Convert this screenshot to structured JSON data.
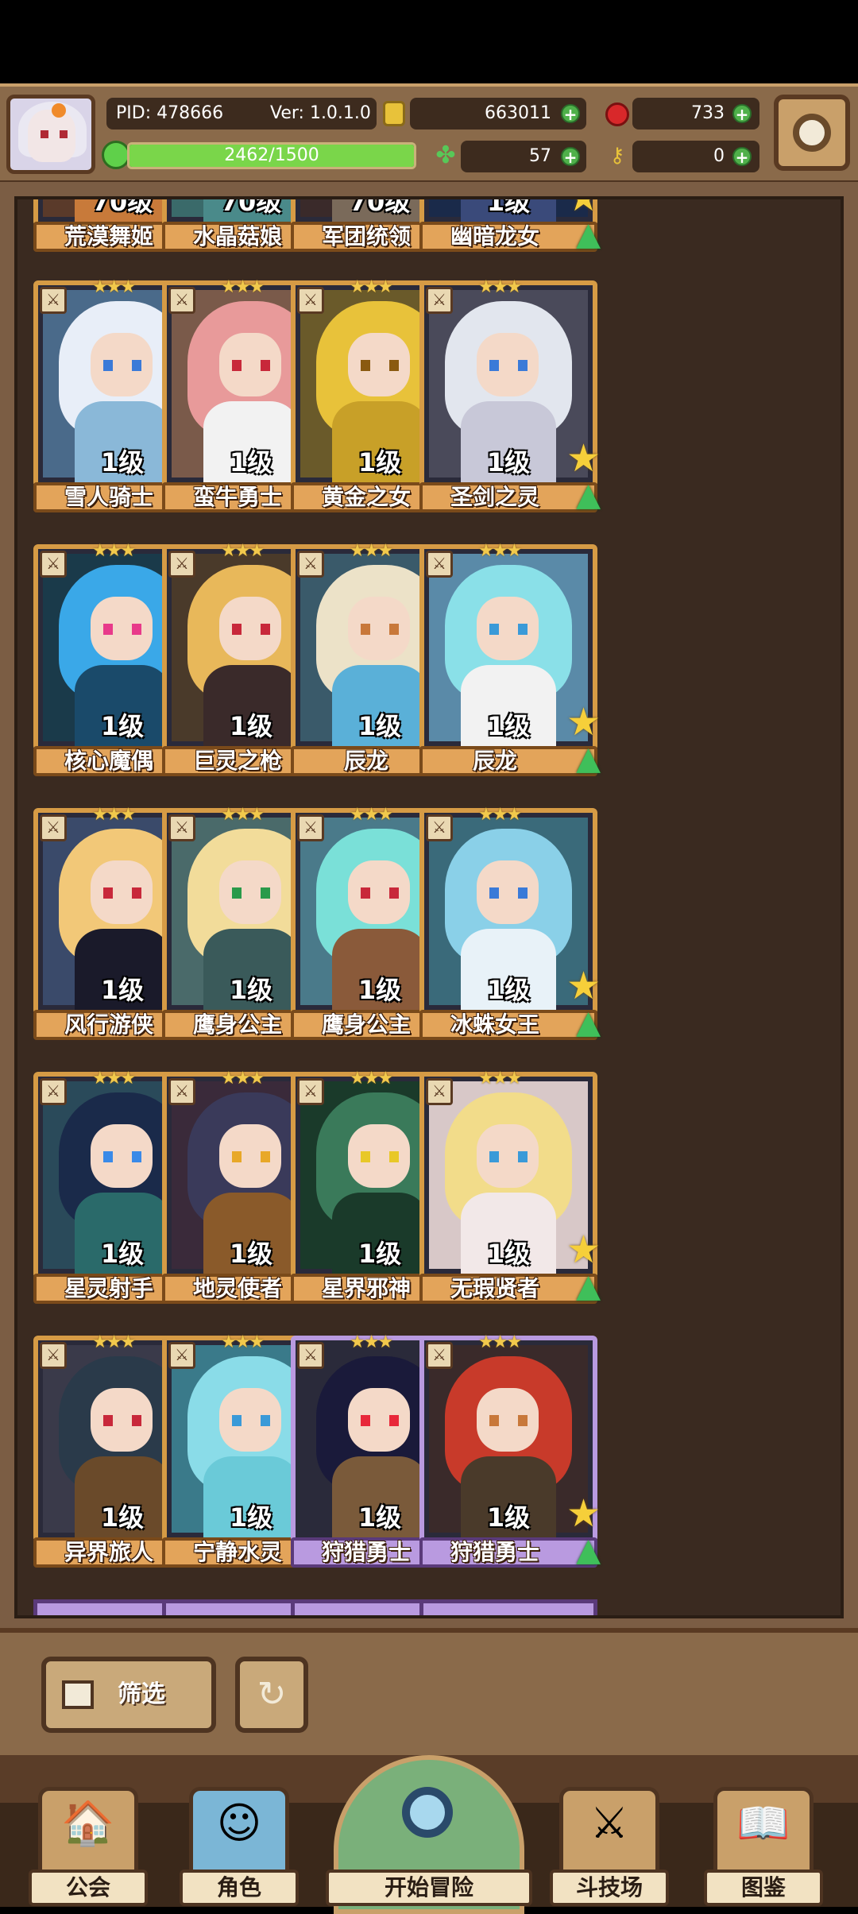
{
  "header": {
    "pid": "PID: 478666",
    "version": "Ver: 1.0.1.0",
    "gold": "663011",
    "gems": "733",
    "energy": "57",
    "keys": "0",
    "xp_text": "2462/1500",
    "xp_fraction": 1.0
  },
  "top_row": [
    {
      "level": "70级",
      "name": "荒漠舞姬"
    },
    {
      "level": "70级",
      "name": "水晶菇娘"
    },
    {
      "level": "70级",
      "name": "军团统领"
    },
    {
      "level": "1级",
      "name": "幽暗龙女"
    }
  ],
  "cards": [
    {
      "level": "1级",
      "name": "雪人骑士",
      "badge": "2",
      "hair": "#e8eef8",
      "body": "#8ab8d8",
      "eye": "#3a7ad8",
      "bg": "#4a6a8a",
      "frame": "gold"
    },
    {
      "level": "1级",
      "name": "蛮牛勇士",
      "badge": "2",
      "hair": "#e89a9a",
      "body": "#f2f2f2",
      "eye": "#c8283a",
      "bg": "#7a5a4a",
      "frame": "gold"
    },
    {
      "level": "1级",
      "name": "黄金之女",
      "badge": "",
      "hair": "#e8c23a",
      "body": "#c8a028",
      "eye": "#8a5a10",
      "bg": "#6a5a2a",
      "frame": "gold"
    },
    {
      "level": "1级",
      "name": "圣剑之灵",
      "badge": "",
      "hair": "#e2e6ee",
      "body": "#c8c8d8",
      "eye": "#3a7ad8",
      "bg": "#4a4a5a",
      "frame": "gold"
    },
    {
      "level": "1级",
      "name": "核心魔偶",
      "badge": "",
      "hair": "#3aa8e8",
      "body": "#1a4a6a",
      "eye": "#e83a8a",
      "bg": "#1a3a4a",
      "frame": "gold"
    },
    {
      "level": "1级",
      "name": "巨灵之枪",
      "badge": "",
      "hair": "#e8b85a",
      "body": "#3a2a2a",
      "eye": "#c8283a",
      "bg": "#4a3a2a",
      "frame": "gold"
    },
    {
      "level": "1级",
      "name": "辰龙",
      "badge": "",
      "hair": "#ece2c8",
      "body": "#5ab0d8",
      "eye": "#c8783a",
      "bg": "#3a5a6a",
      "frame": "gold"
    },
    {
      "level": "1级",
      "name": "辰龙",
      "badge": "",
      "hair": "#8ae0e8",
      "body": "#f2f2f2",
      "eye": "#3a9ad8",
      "bg": "#5a8aa8",
      "frame": "gold"
    },
    {
      "level": "1级",
      "name": "风行游侠",
      "badge": "",
      "hair": "#f2c878",
      "body": "#1a1a2a",
      "eye": "#c8283a",
      "bg": "#3a4a6a",
      "frame": "gold"
    },
    {
      "level": "1级",
      "name": "鹰身公主",
      "badge": "",
      "hair": "#f2dc9a",
      "body": "#3a5a5a",
      "eye": "#2a9a4a",
      "bg": "#4a6a6a",
      "frame": "gold"
    },
    {
      "level": "1级",
      "name": "鹰身公主",
      "badge": "",
      "hair": "#7ae0d8",
      "body": "#8a5a3a",
      "eye": "#c8283a",
      "bg": "#4a7a8a",
      "frame": "gold"
    },
    {
      "level": "1级",
      "name": "冰蛛女王",
      "badge": "",
      "hair": "#8ad0e8",
      "body": "#e8f2f8",
      "eye": "#3a7ad8",
      "bg": "#3a6a7a",
      "frame": "gold"
    },
    {
      "level": "1级",
      "name": "星灵射手",
      "badge": "",
      "hair": "#1a2a4a",
      "body": "#2a6a6a",
      "eye": "#3a8ae8",
      "bg": "#2a4a5a",
      "frame": "gold"
    },
    {
      "level": "1级",
      "name": "地灵使者",
      "badge": "",
      "hair": "#3a3a5a",
      "body": "#8a5a2a",
      "eye": "#e8a828",
      "bg": "#3a2a3a",
      "frame": "gold"
    },
    {
      "level": "1级",
      "name": "星界邪神",
      "badge": "planet",
      "hair": "#3a7a5a",
      "body": "#1a3a2a",
      "eye": "#e8c828",
      "bg": "#1a3a2a",
      "frame": "gold"
    },
    {
      "level": "1级",
      "name": "无瑕贤者",
      "badge": "",
      "hair": "#f2dc8a",
      "body": "#f2e8e8",
      "eye": "#3a9ad8",
      "bg": "#d8c8c8",
      "frame": "gold"
    },
    {
      "level": "1级",
      "name": "异界旅人",
      "badge": "",
      "hair": "#2a3a4a",
      "body": "#6a4a2a",
      "eye": "#c8283a",
      "bg": "#3a3a4a",
      "frame": "gold"
    },
    {
      "level": "1级",
      "name": "宁静水灵",
      "badge": "",
      "hair": "#8adce8",
      "body": "#6acad8",
      "eye": "#3a9ad8",
      "bg": "#3a7a8a",
      "frame": "gold"
    },
    {
      "level": "1级",
      "name": "狩猎勇士",
      "badge": "",
      "hair": "#1a1a3a",
      "body": "#7a5a3a",
      "eye": "#e8283a",
      "bg": "#2a2a3a",
      "frame": "purple"
    },
    {
      "level": "1级",
      "name": "狩猎勇士",
      "badge": "",
      "hair": "#c83a2a",
      "body": "#4a3a2a",
      "eye": "#c8783a",
      "bg": "#3a2a2a",
      "frame": "purple"
    }
  ],
  "toolbar": {
    "filter_label": "筛选"
  },
  "nav": {
    "guild": "公会",
    "characters": "角色",
    "start": "开始冒险",
    "arena": "斗技场",
    "codex": "图鉴"
  }
}
